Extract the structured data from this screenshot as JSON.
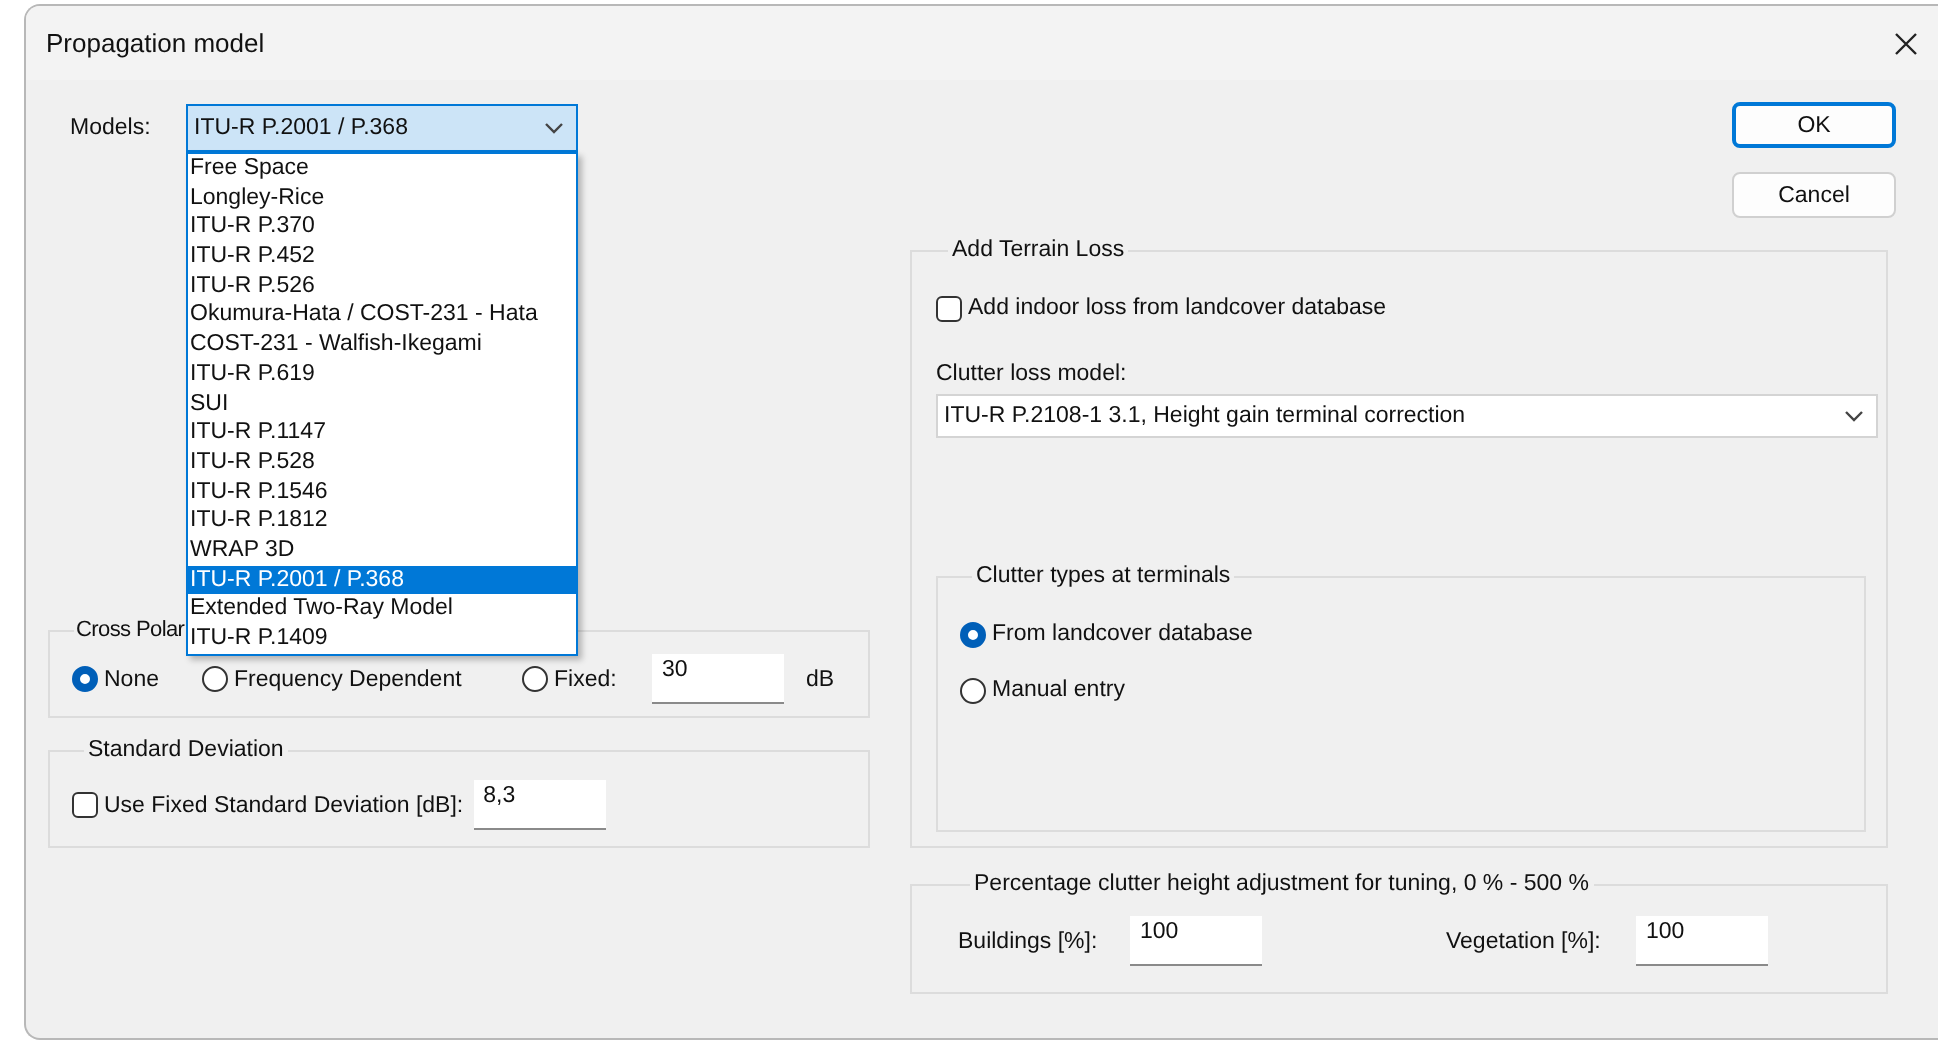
{
  "window": {
    "title": "Propagation model"
  },
  "models": {
    "label": "Models:",
    "value": "ITU-R P.2001 / P.368",
    "open": true,
    "options": [
      {
        "label": "Free Space",
        "selected": false
      },
      {
        "label": "Longley-Rice",
        "selected": false
      },
      {
        "label": "ITU-R P.370",
        "selected": false
      },
      {
        "label": "ITU-R P.452",
        "selected": false
      },
      {
        "label": "ITU-R P.526",
        "selected": false
      },
      {
        "label": "Okumura-Hata / COST-231 - Hata",
        "selected": false
      },
      {
        "label": "COST-231 - Walfish-Ikegami",
        "selected": false
      },
      {
        "label": "ITU-R P.619",
        "selected": false
      },
      {
        "label": "SUI",
        "selected": false
      },
      {
        "label": "ITU-R P.1147",
        "selected": false
      },
      {
        "label": "ITU-R P.528",
        "selected": false
      },
      {
        "label": "ITU-R P.1546",
        "selected": false
      },
      {
        "label": "ITU-R P.1812",
        "selected": false
      },
      {
        "label": "WRAP 3D",
        "selected": false
      },
      {
        "label": "ITU-R P.2001 / P.368",
        "selected": true
      },
      {
        "label": "Extended Two-Ray Model",
        "selected": false
      },
      {
        "label": "ITU-R P.1409",
        "selected": false
      }
    ]
  },
  "buttons": [
    {
      "label": "OK",
      "default": true
    },
    {
      "label": "Cancel",
      "default": false
    }
  ],
  "cross_polar": {
    "title": "Cross Polar",
    "options": [
      {
        "label": "None",
        "selected": true
      },
      {
        "label": "Frequency Dependent",
        "selected": false
      },
      {
        "label": "Fixed:",
        "selected": false
      }
    ],
    "fixed_value": "30",
    "unit": "dB"
  },
  "standard_deviation": {
    "title": "Standard Deviation",
    "checkbox": {
      "label": "Use Fixed Standard Deviation [dB]:",
      "checked": false
    },
    "value": "8,3"
  },
  "terrain_loss": {
    "title": "Add Terrain Loss",
    "indoor_loss": {
      "label": "Add indoor loss from landcover database",
      "checked": false
    },
    "clutter_label": "Clutter loss model:",
    "clutter_value": "ITU-R P.2108-1 3.1, Height gain terminal correction",
    "clutter_types": {
      "title": "Clutter types at terminals",
      "options": [
        {
          "label": "From landcover database",
          "selected": true
        },
        {
          "label": "Manual entry",
          "selected": false
        }
      ]
    }
  },
  "clutter_height": {
    "title": "Percentage clutter height adjustment for tuning, 0 % - 500 %",
    "fields": [
      {
        "label": "Buildings [%]:",
        "value": "100"
      },
      {
        "label": "Vegetation [%]:",
        "value": "100"
      }
    ]
  }
}
